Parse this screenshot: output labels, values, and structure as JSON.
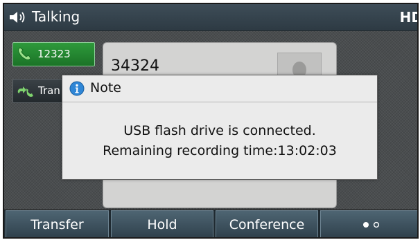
{
  "status_bar": {
    "icon": "speaker-icon",
    "text": "Talking",
    "badge": "HD"
  },
  "calls": [
    {
      "icon": "phone-icon",
      "label": "12323",
      "state": "active",
      "color": "#2e9a3b"
    },
    {
      "icon": "transfer-icon",
      "label": "Tran",
      "state": "transferring"
    }
  ],
  "contact": {
    "number": "34324",
    "avatar_icon": "person-icon"
  },
  "note": {
    "icon": "info-icon",
    "title": "Note",
    "line1": "USB flash drive is connected.",
    "line2": "Remaining recording time:13:02:03"
  },
  "softkeys": [
    {
      "label": "Transfer"
    },
    {
      "label": "Hold"
    },
    {
      "label": "Conference"
    },
    {
      "icon": "page-dots-icon",
      "pages": 2,
      "current": 1
    }
  ]
}
